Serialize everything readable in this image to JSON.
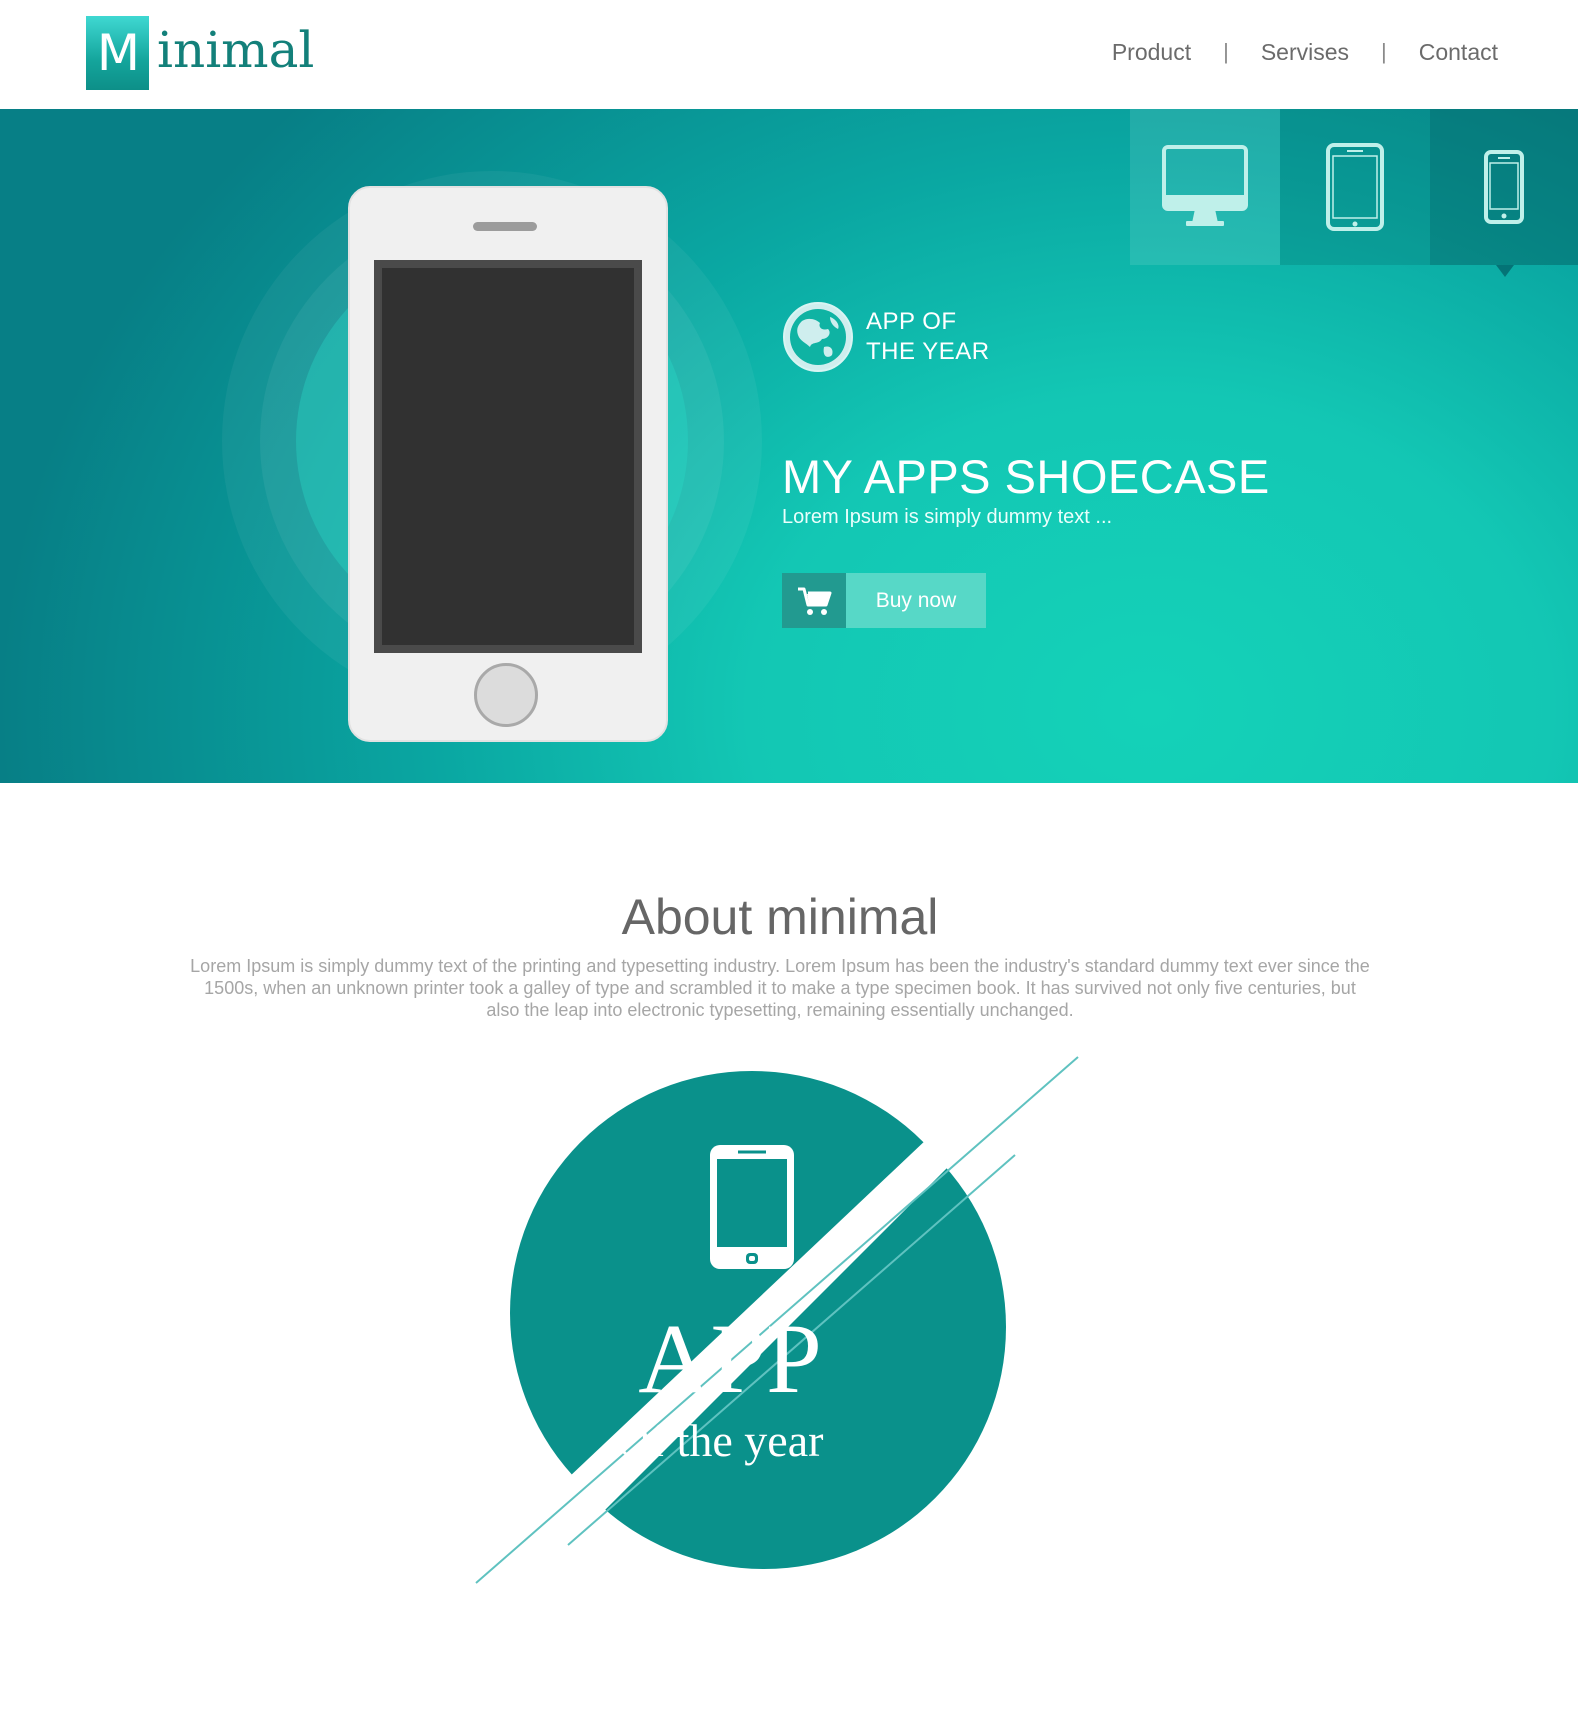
{
  "header": {
    "logo_letter": "M",
    "logo_rest": "inimal",
    "nav": [
      "Product",
      "Servises",
      "Contact"
    ],
    "nav_separator": "|"
  },
  "hero": {
    "device_tabs": [
      "desktop-icon",
      "tablet-icon",
      "phone-icon"
    ],
    "active_tab": "phone",
    "award_line1": "APP OF",
    "award_line2": "THE YEAR",
    "title": "MY APPS SHOECASE",
    "subtitle": "Lorem Ipsum is simply dummy text ...",
    "buy_label": "Buy now"
  },
  "about": {
    "title": "About minimal",
    "text": "Lorem Ipsum is simply dummy text of the printing and typesetting industry. Lorem Ipsum has been the industry's standard dummy text ever since the 1500s, when an unknown printer took a galley of type and scrambled it to make a type specimen book. It has survived not only five centuries, but also the leap into electronic typesetting, remaining essentially unchanged."
  },
  "badge": {
    "line1": "APP",
    "line2": "Of the year"
  },
  "colors": {
    "accent": "#0a918b",
    "hero_light": "#14d2b8",
    "hero_dark": "#077f86",
    "button_light": "#57d8c7",
    "button_dark": "#229a90"
  }
}
